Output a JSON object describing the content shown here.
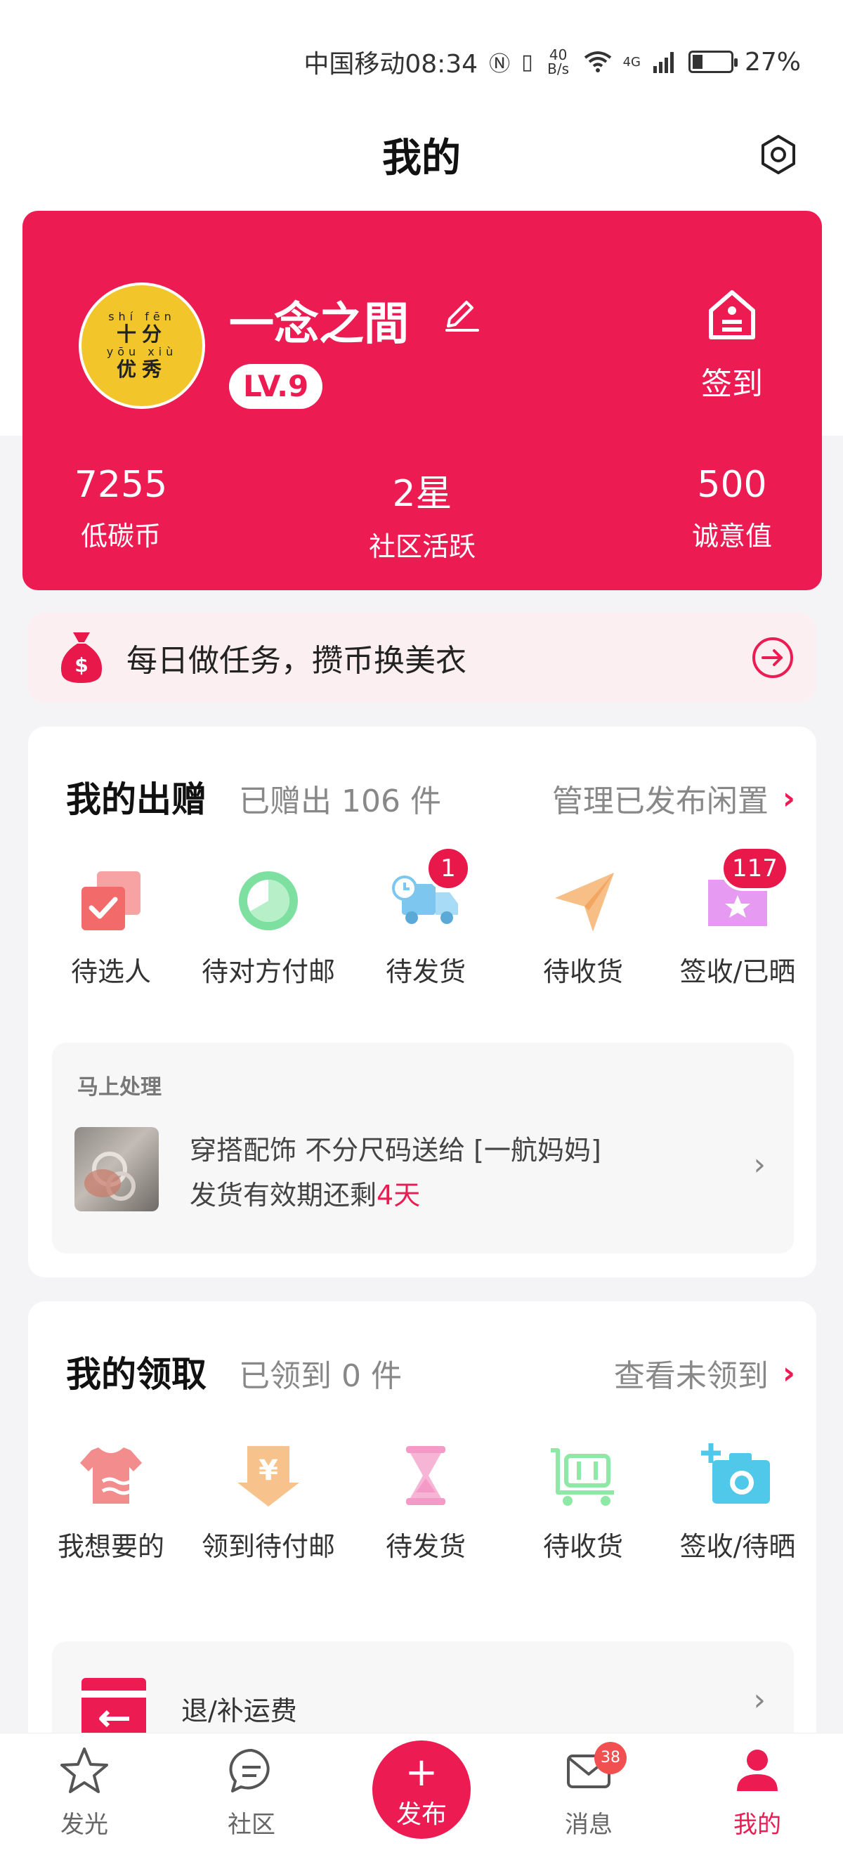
{
  "status_bar": {
    "carrier_time": "中国移动08:34",
    "net_speed": "40 B/s",
    "signal": "4G",
    "battery": "27%",
    "battery_level": 0.27
  },
  "header": {
    "title": "我的",
    "settings_icon": "gear-icon"
  },
  "profile": {
    "avatar_ruby_top": "shí  fēn",
    "avatar_text_top": "十分",
    "avatar_ruby_bottom": "yōu  xiù",
    "avatar_text_bottom": "优秀",
    "username": "一念之間",
    "level": "LV.9",
    "signin_label": "签到",
    "stats": [
      {
        "value": "7255",
        "label": "低碳币"
      },
      {
        "value": "2星",
        "label": "社区活跃"
      },
      {
        "value": "500",
        "label": "诚意值"
      }
    ]
  },
  "promo": {
    "text": "每日做任务，攒币换美衣"
  },
  "giving": {
    "title": "我的出赠",
    "subtitle": "已赠出  106  件",
    "manage_link": "管理已发布闲置",
    "items": [
      {
        "label": "待选人",
        "icon": "checkbox-stack-icon",
        "color": "#f26a6a",
        "badge": ""
      },
      {
        "label": "待对方付邮",
        "icon": "clock-circle-icon",
        "color": "#7ee0a0",
        "badge": ""
      },
      {
        "label": "待发货",
        "icon": "delivery-truck-icon",
        "color": "#7cc6ef",
        "badge": "1"
      },
      {
        "label": "待收货",
        "icon": "paper-plane-icon",
        "color": "#f7bf86",
        "badge": ""
      },
      {
        "label": "签收/已晒",
        "icon": "star-folder-icon",
        "color": "#e79af2",
        "badge": "117"
      }
    ],
    "todo": {
      "title": "马上处理",
      "line1": "穿搭配饰  不分尺码送给  [一航妈妈]",
      "line2_prefix": "发货有效期还剩",
      "line2_highlight": "4天"
    }
  },
  "receiving": {
    "title": "我的领取",
    "subtitle": "已领到  0  件",
    "link": "查看未领到",
    "items": [
      {
        "label": "我想要的",
        "icon": "tshirt-icon",
        "color": "#f38d8d"
      },
      {
        "label": "领到待付邮",
        "icon": "yen-arrow-icon",
        "color": "#f7c28c"
      },
      {
        "label": "待发货",
        "icon": "hourglass-icon",
        "color": "#f49ac6"
      },
      {
        "label": "待收货",
        "icon": "luggage-cart-icon",
        "color": "#8ee8a6"
      },
      {
        "label": "签收/待晒",
        "icon": "camera-plus-icon",
        "color": "#4fc8ea"
      }
    ],
    "refund": {
      "label": "退/补运费",
      "icon": "wallet-return-icon"
    }
  },
  "bottom_nav": {
    "items": [
      {
        "label": "发光",
        "icon": "star-icon"
      },
      {
        "label": "社区",
        "icon": "chat-bubble-icon"
      },
      {
        "label": "发布",
        "icon": "plus-icon"
      },
      {
        "label": "消息",
        "icon": "mail-icon",
        "badge": "38"
      },
      {
        "label": "我的",
        "icon": "person-icon"
      }
    ],
    "active": "我的"
  },
  "colors": {
    "brand": "#ec1c53",
    "page_bg": "#f4f4f6"
  }
}
